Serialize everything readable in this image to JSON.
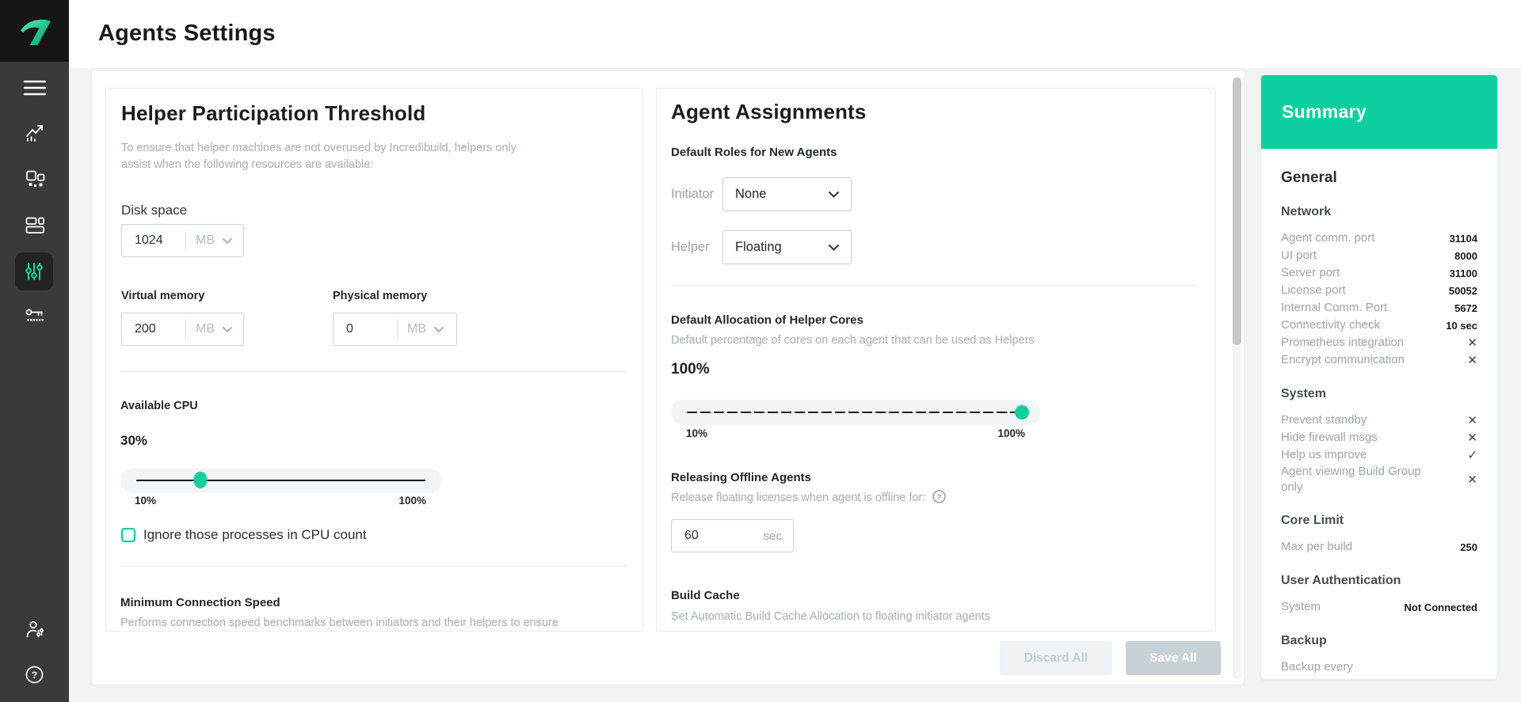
{
  "header": {
    "title": "Agents Settings"
  },
  "sidebar": {
    "active": "agent-settings",
    "items": [
      "menu",
      "analytics",
      "build-groups",
      "dashboard",
      "agent-settings",
      "license"
    ],
    "bottom_items": [
      "user-settings",
      "help"
    ]
  },
  "helper_threshold": {
    "title": "Helper Participation Threshold",
    "description": "To ensure that helper machines are not overused by Incredibuild, helpers only assist when the following resources are available:",
    "disk_space": {
      "label": "Disk space",
      "value": "1024",
      "unit": "MB"
    },
    "virtual_memory": {
      "label": "Virtual memory",
      "value": "200",
      "unit": "MB"
    },
    "physical_memory": {
      "label": "Physical memory",
      "value": "0",
      "unit": "MB"
    },
    "available_cpu": {
      "label": "Available CPU",
      "value": "30%",
      "min_label": "10%",
      "max_label": "100%"
    },
    "ignore_cpu_checkbox": {
      "label": "Ignore those processes in CPU count",
      "checked": false
    },
    "min_connection_speed": {
      "title": "Minimum Connection Speed",
      "description": "Performs connection speed benchmarks between initiators and their helpers to ensure"
    }
  },
  "agent_assignments": {
    "title": "Agent Assignments",
    "default_roles": {
      "title": "Default Roles for New Agents",
      "initiator": {
        "label": "Initiator",
        "value": "None"
      },
      "helper": {
        "label": "Helper",
        "value": "Floating"
      }
    },
    "helper_cores": {
      "title": "Default Allocation of Helper Cores",
      "description": "Default percentage of cores on each agent that can be used as Helpers",
      "value": "100%",
      "min_label": "10%",
      "max_label": "100%"
    },
    "releasing_offline": {
      "title": "Releasing Offline Agents",
      "description": "Release floating licenses when agent is offline for:",
      "value": "60",
      "unit": "sec"
    },
    "build_cache": {
      "title": "Build Cache",
      "description": "Set Automatic Build Cache Allocation to floating initiator agents"
    }
  },
  "footer": {
    "discard_label": "Discard All",
    "save_label": "Save All"
  },
  "summary": {
    "title": "Summary",
    "heading": "General",
    "groups": [
      {
        "heading": "Network",
        "rows": [
          {
            "label": "Agent comm. port",
            "value": "31104"
          },
          {
            "label": "UI port",
            "value": "8000"
          },
          {
            "label": "Server port",
            "value": "31100"
          },
          {
            "label": "License port",
            "value": "50052"
          },
          {
            "label": "Internal Comm. Port",
            "value": "5672"
          },
          {
            "label": "Connectivity check",
            "value": "10 sec"
          },
          {
            "label": "Prometheus integration",
            "mark": "cross"
          },
          {
            "label": "Encrypt communication",
            "mark": "cross"
          }
        ]
      },
      {
        "heading": "System",
        "rows": [
          {
            "label": "Prevent standby",
            "mark": "cross"
          },
          {
            "label": "Hide firewall msgs",
            "mark": "cross"
          },
          {
            "label": "Help us improve",
            "mark": "check"
          },
          {
            "label": "Agent viewing Build Group only",
            "mark": "cross"
          }
        ]
      },
      {
        "heading": "Core Limit",
        "rows": [
          {
            "label": "Max per build",
            "value": "250"
          }
        ]
      },
      {
        "heading": "User Authentication",
        "rows": [
          {
            "label": "System",
            "value": "Not Connected"
          }
        ]
      },
      {
        "heading": "Backup",
        "rows": [
          {
            "label": "Backup every",
            "value": ""
          }
        ]
      }
    ]
  },
  "colors": {
    "accent": "#0bcf9e",
    "sidebar": "#3a3a3a",
    "text_dark": "#20262b",
    "text_gray": "#a4aeb5"
  }
}
